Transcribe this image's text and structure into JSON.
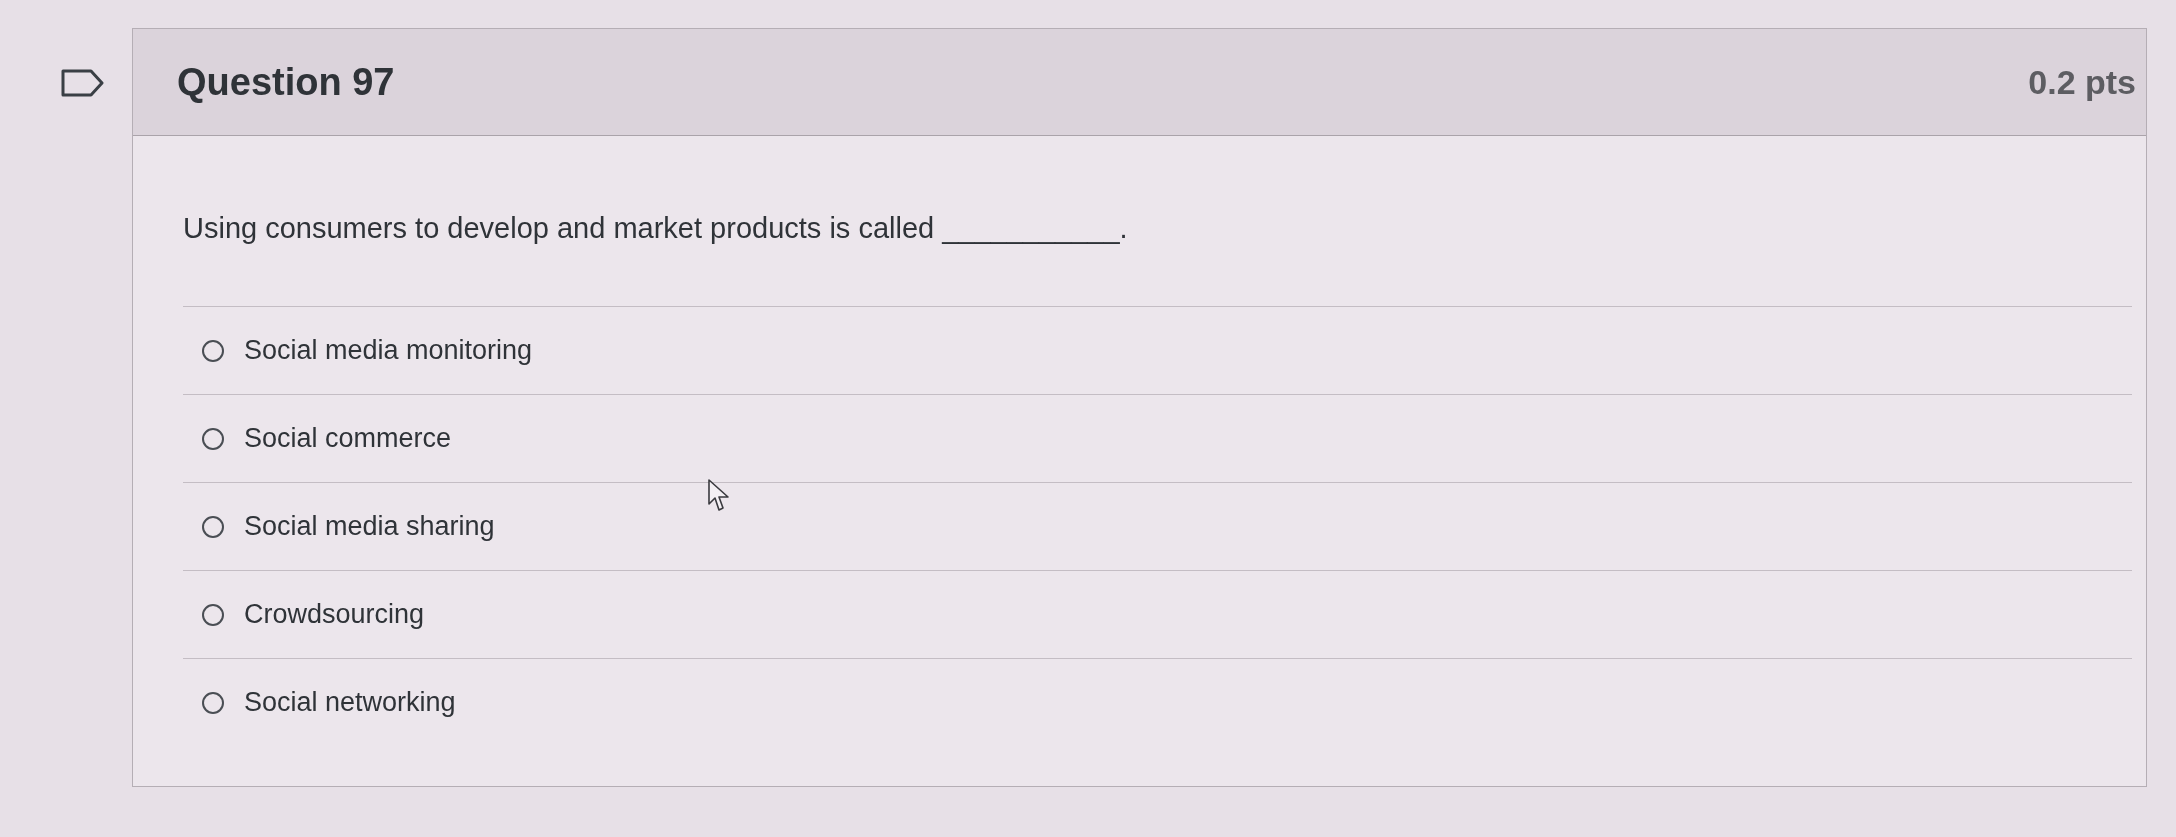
{
  "question": {
    "flagged": false,
    "title": "Question 97",
    "points": "0.2 pts",
    "text": "Using consumers to develop and market products is called ___________."
  },
  "answers": [
    {
      "label": "Social media monitoring",
      "selected": false
    },
    {
      "label": "Social commerce",
      "selected": false
    },
    {
      "label": "Social media sharing",
      "selected": false
    },
    {
      "label": "Crowdsourcing",
      "selected": false
    },
    {
      "label": "Social networking",
      "selected": false
    }
  ]
}
